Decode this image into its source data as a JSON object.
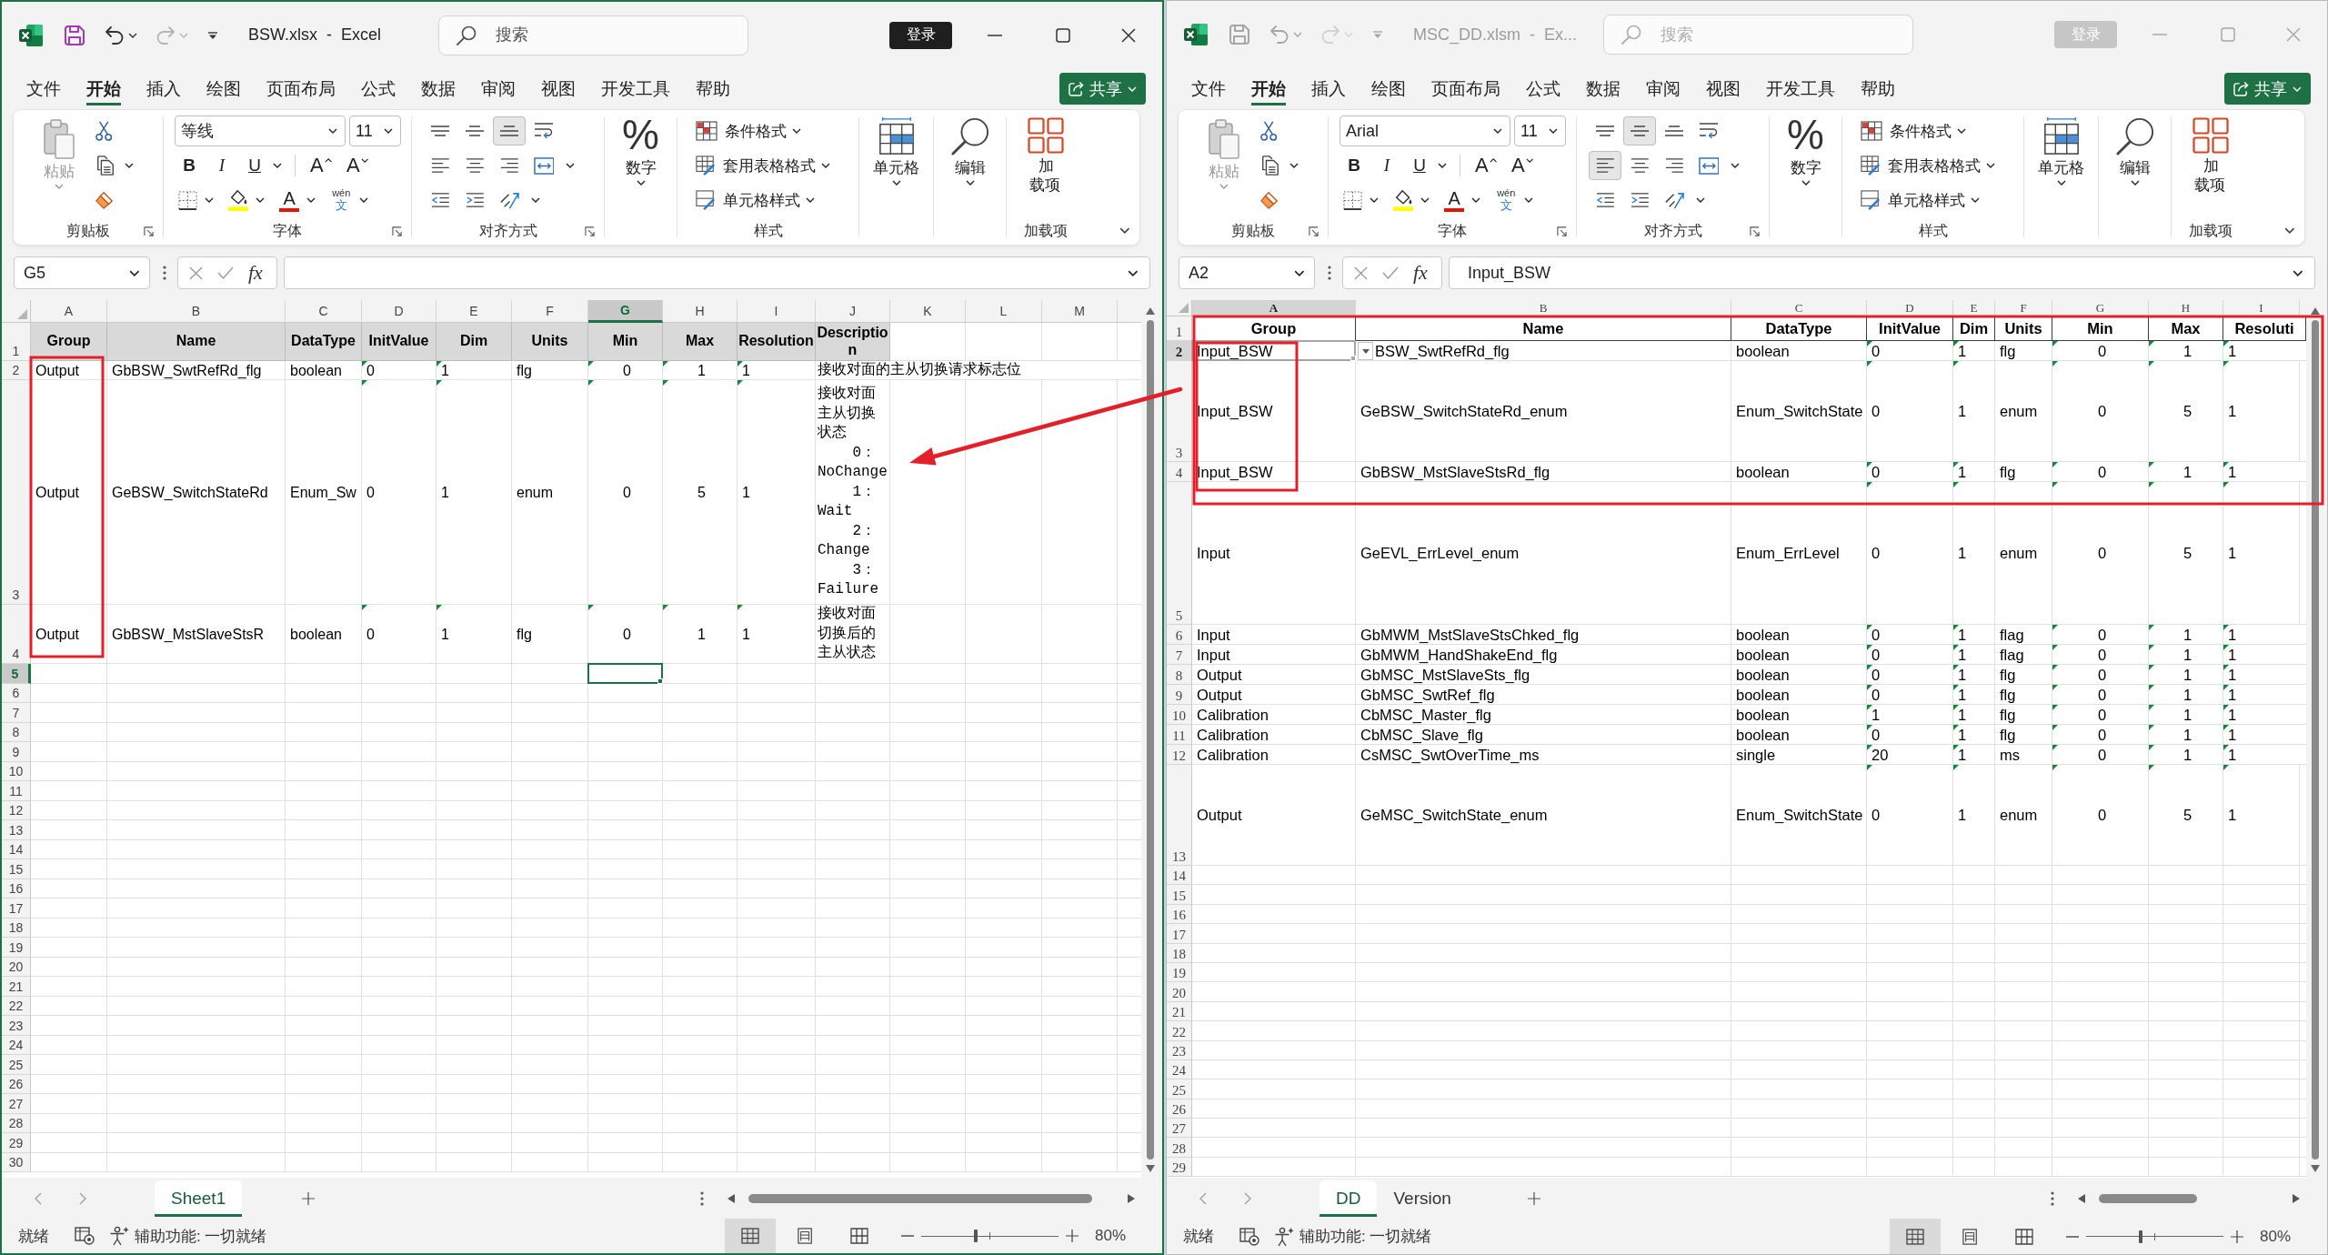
{
  "windows": [
    {
      "active": true,
      "title": "BSW.xlsx  -  Excel",
      "quick_access": [
        {
          "kind": "save",
          "disabled": false
        },
        {
          "kind": "undo",
          "disabled": false
        },
        {
          "kind": "redo",
          "disabled": true
        }
      ],
      "search": {
        "placeholder": "搜索"
      },
      "sign_in": "登录",
      "menu_tabs": [
        {
          "label": "文件",
          "selected": false
        },
        {
          "label": "开始",
          "selected": true
        },
        {
          "label": "插入",
          "selected": false
        },
        {
          "label": "绘图",
          "selected": false
        },
        {
          "label": "页面布局",
          "selected": false
        },
        {
          "label": "公式",
          "selected": false
        },
        {
          "label": "数据",
          "selected": false
        },
        {
          "label": "审阅",
          "selected": false
        },
        {
          "label": "视图",
          "selected": false
        },
        {
          "label": "开发工具",
          "selected": false
        },
        {
          "label": "帮助",
          "selected": false
        }
      ],
      "share": "共享",
      "ribbon": {
        "clipboard": {
          "paste": {
            "label": "粘贴",
            "disabled": true
          },
          "label": "剪贴板"
        },
        "font": {
          "name": "等线",
          "size": "11",
          "styles": [
            {
              "kind": "bold",
              "label": "B"
            },
            {
              "kind": "italic",
              "label": "I"
            },
            {
              "kind": "underline",
              "label": "U"
            }
          ],
          "sizers": [
            {
              "kind": "grow",
              "label": "A"
            },
            {
              "kind": "shrink",
              "label": "A"
            }
          ],
          "font_color": "A",
          "phonetic": {
            "pinyin": "wén",
            "character": "文"
          },
          "label": "字体"
        },
        "alignment": {
          "buttons": [
            {
              "kind": "top",
              "selected": false
            },
            {
              "kind": "middle",
              "selected": false
            },
            {
              "kind": "bottom",
              "selected": true
            },
            {
              "kind": "wrap",
              "selected": false
            },
            {
              "kind": "left",
              "selected": false
            },
            {
              "kind": "center",
              "selected": false
            },
            {
              "kind": "right",
              "selected": false
            },
            {
              "kind": "merge",
              "selected": false
            },
            {
              "kind": "outdent",
              "selected": false
            },
            {
              "kind": "indent",
              "selected": false
            },
            {
              "kind": "orientation",
              "selected": false
            }
          ],
          "label": "对齐方式"
        },
        "number": {
          "symbol": "%",
          "label": "数字"
        },
        "styles": {
          "items": [
            "条件格式",
            "套用表格格式",
            "单元格样式"
          ],
          "label": "样式"
        },
        "cells": {
          "label": "单元格"
        },
        "editing": {
          "label": "编辑"
        },
        "add_ins": {
          "button": "加载项",
          "label": "加载项"
        }
      },
      "name_box": "G5",
      "function_label": "fx",
      "sheet": {
        "columns": [
          {
            "label": "A",
            "selected": false
          },
          {
            "label": "B",
            "selected": false
          },
          {
            "label": "C",
            "selected": false
          },
          {
            "label": "D",
            "selected": false
          },
          {
            "label": "E",
            "selected": false
          },
          {
            "label": "F",
            "selected": false
          },
          {
            "label": "G",
            "selected": true
          },
          {
            "label": "H",
            "selected": false
          },
          {
            "label": "I",
            "selected": false
          },
          {
            "label": "J",
            "selected": false
          },
          {
            "label": "K",
            "selected": false
          },
          {
            "label": "L",
            "selected": false
          },
          {
            "label": "M",
            "selected": false
          }
        ],
        "rows": [
          {
            "number": "1",
            "selected": false,
            "cells": [
              {
                "text": "Group",
                "flagged": false
              },
              {
                "text": "Name",
                "flagged": false
              },
              {
                "text": "DataType",
                "flagged": false
              },
              {
                "text": "InitValue",
                "flagged": false
              },
              {
                "text": "Dim",
                "flagged": false
              },
              {
                "text": "Units",
                "flagged": false
              },
              {
                "text": "Min",
                "flagged": false
              },
              {
                "text": "Max",
                "flagged": false
              },
              {
                "text": "Resolution",
                "flagged": false
              },
              {
                "text": "Description",
                "flagged": false
              }
            ]
          },
          {
            "number": "2",
            "selected": false,
            "cells": [
              {
                "text": "Output",
                "flagged": false
              },
              {
                "text": "GbBSW_SwtRefRd_flg",
                "flagged": false
              },
              {
                "text": "boolean",
                "flagged": false
              },
              {
                "text": "0",
                "flagged": true
              },
              {
                "text": "1",
                "flagged": true
              },
              {
                "text": "flg",
                "flagged": false
              },
              {
                "text": "0",
                "flagged": true
              },
              {
                "text": "1",
                "flagged": true
              },
              {
                "text": "1",
                "flagged": true
              },
              {
                "text": "接收对面的主从切换请求标志位",
                "flagged": false
              }
            ]
          },
          {
            "number": "3",
            "selected": false,
            "cells": [
              {
                "text": "Output",
                "flagged": false
              },
              {
                "text": "GeBSW_SwitchStateRd",
                "flagged": false
              },
              {
                "text": "Enum_Sw",
                "flagged": false
              },
              {
                "text": "0",
                "flagged": true
              },
              {
                "text": "1",
                "flagged": true
              },
              {
                "text": "enum",
                "flagged": false
              },
              {
                "text": "0",
                "flagged": true
              },
              {
                "text": "5",
                "flagged": true
              },
              {
                "text": "1",
                "flagged": true
              },
              {
                "text": "接收对面主从切换状态\n    0：NoChange\n    1：Wait\n    2：Change\n    3：Failure",
                "flagged": false
              }
            ]
          },
          {
            "number": "4",
            "selected": false,
            "cells": [
              {
                "text": "Output",
                "flagged": false
              },
              {
                "text": "GbBSW_MstSlaveStsR",
                "flagged": false
              },
              {
                "text": "boolean",
                "flagged": false
              },
              {
                "text": "0",
                "flagged": true
              },
              {
                "text": "1",
                "flagged": true
              },
              {
                "text": "flg",
                "flagged": false
              },
              {
                "text": "0",
                "flagged": true
              },
              {
                "text": "1",
                "flagged": true
              },
              {
                "text": "1",
                "flagged": true
              },
              {
                "text": "接收对面切换后的主从状态",
                "flagged": false
              }
            ]
          },
          {
            "number": "5",
            "selected": true
          },
          {
            "number": "6",
            "selected": false
          },
          {
            "number": "7",
            "selected": false
          },
          {
            "number": "8",
            "selected": false
          },
          {
            "number": "9",
            "selected": false
          },
          {
            "number": "10",
            "selected": false
          },
          {
            "number": "11",
            "selected": false
          },
          {
            "number": "12",
            "selected": false
          },
          {
            "number": "13",
            "selected": false
          },
          {
            "number": "14",
            "selected": false
          },
          {
            "number": "15",
            "selected": false
          },
          {
            "number": "16",
            "selected": false
          },
          {
            "number": "17",
            "selected": false
          },
          {
            "number": "18",
            "selected": false
          },
          {
            "number": "19",
            "selected": false
          },
          {
            "number": "20",
            "selected": false
          },
          {
            "number": "21",
            "selected": false
          },
          {
            "number": "22",
            "selected": false
          },
          {
            "number": "23",
            "selected": false
          },
          {
            "number": "24",
            "selected": false
          },
          {
            "number": "25",
            "selected": false
          },
          {
            "number": "26",
            "selected": false
          },
          {
            "number": "27",
            "selected": false
          },
          {
            "number": "28",
            "selected": false
          },
          {
            "number": "29",
            "selected": false
          },
          {
            "number": "30",
            "selected": false
          }
        ]
      },
      "sheet_tabs": [
        {
          "label": "Sheet1",
          "selected": true
        }
      ],
      "status": {
        "ready": "就绪",
        "accessibility": "辅助功能: 一切就绪",
        "views": [
          {
            "kind": "normal",
            "selected": true
          },
          {
            "kind": "page_layout",
            "selected": false
          },
          {
            "kind": "page_break",
            "selected": false
          }
        ],
        "zoom_slider": {
          "level": 0.4
        },
        "zoom": "80%"
      }
    },
    {
      "active": false,
      "title": "MSC_DD.xlsm  -  Ex...",
      "quick_access": [
        {
          "kind": "save",
          "disabled": false
        },
        {
          "kind": "undo",
          "disabled": false
        },
        {
          "kind": "redo",
          "disabled": true
        }
      ],
      "search": {
        "placeholder": "搜索"
      },
      "sign_in": "登录",
      "menu_tabs": [
        {
          "label": "文件",
          "selected": false
        },
        {
          "label": "开始",
          "selected": true
        },
        {
          "label": "插入",
          "selected": false
        },
        {
          "label": "绘图",
          "selected": false
        },
        {
          "label": "页面布局",
          "selected": false
        },
        {
          "label": "公式",
          "selected": false
        },
        {
          "label": "数据",
          "selected": false
        },
        {
          "label": "审阅",
          "selected": false
        },
        {
          "label": "视图",
          "selected": false
        },
        {
          "label": "开发工具",
          "selected": false
        },
        {
          "label": "帮助",
          "selected": false
        }
      ],
      "share": "共享",
      "ribbon": {
        "clipboard": {
          "paste": {
            "label": "粘贴",
            "disabled": true
          },
          "label": "剪贴板"
        },
        "font": {
          "name": "Arial",
          "size": "11",
          "styles": [
            {
              "kind": "bold",
              "label": "B"
            },
            {
              "kind": "italic",
              "label": "I"
            },
            {
              "kind": "underline",
              "label": "U"
            }
          ],
          "sizers": [
            {
              "kind": "grow",
              "label": "A"
            },
            {
              "kind": "shrink",
              "label": "A"
            }
          ],
          "font_color": "A",
          "phonetic": {
            "pinyin": "wén",
            "character": "文"
          },
          "label": "字体"
        },
        "alignment": {
          "buttons": [
            {
              "kind": "top",
              "selected": false
            },
            {
              "kind": "middle",
              "selected": true
            },
            {
              "kind": "bottom",
              "selected": false
            },
            {
              "kind": "wrap",
              "selected": false
            },
            {
              "kind": "left",
              "selected": true
            },
            {
              "kind": "center",
              "selected": false
            },
            {
              "kind": "right",
              "selected": false
            },
            {
              "kind": "merge",
              "selected": false
            },
            {
              "kind": "outdent",
              "selected": false
            },
            {
              "kind": "indent",
              "selected": false
            },
            {
              "kind": "orientation",
              "selected": false
            }
          ],
          "label": "对齐方式"
        },
        "number": {
          "symbol": "%",
          "label": "数字"
        },
        "styles": {
          "items": [
            "条件格式",
            "套用表格格式",
            "单元格样式"
          ],
          "label": "样式"
        },
        "cells": {
          "label": "单元格"
        },
        "editing": {
          "label": "编辑"
        },
        "add_ins": {
          "button": "加载项",
          "label": "加载项"
        }
      },
      "name_box": "A2",
      "function_label": "fx",
      "formula": "Input_BSW",
      "sheet": {
        "columns": [
          {
            "label": "A",
            "selected": true
          },
          {
            "label": "B",
            "selected": false
          },
          {
            "label": "C",
            "selected": false
          },
          {
            "label": "D",
            "selected": false
          },
          {
            "label": "E",
            "selected": false
          },
          {
            "label": "F",
            "selected": false
          },
          {
            "label": "G",
            "selected": false
          },
          {
            "label": "H",
            "selected": false
          },
          {
            "label": "I",
            "selected": false
          }
        ],
        "selection_dropdown": true,
        "rows": [
          {
            "number": "1",
            "selected": false,
            "cells": [
              {
                "text": "Group",
                "flagged": false
              },
              {
                "text": "Name",
                "flagged": false
              },
              {
                "text": "DataType",
                "flagged": false
              },
              {
                "text": "InitValue",
                "flagged": false
              },
              {
                "text": "Dim",
                "flagged": false
              },
              {
                "text": "Units",
                "flagged": false
              },
              {
                "text": "Min",
                "flagged": false
              },
              {
                "text": "Max",
                "flagged": false
              },
              {
                "text": "Resoluti",
                "flagged": false
              }
            ]
          },
          {
            "number": "2",
            "selected": true,
            "cells": [
              {
                "text": "Input_BSW",
                "flagged": false
              },
              {
                "text": "BSW_SwtRefRd_flg",
                "flagged": false
              },
              {
                "text": "boolean",
                "flagged": false
              },
              {
                "text": "0",
                "flagged": true
              },
              {
                "text": "1",
                "flagged": true
              },
              {
                "text": "flg",
                "flagged": false
              },
              {
                "text": "0",
                "flagged": true
              },
              {
                "text": "1",
                "flagged": true
              },
              {
                "text": "1",
                "flagged": true
              }
            ]
          },
          {
            "number": "3",
            "selected": false,
            "cells": [
              {
                "text": "Input_BSW",
                "flagged": false
              },
              {
                "text": "GeBSW_SwitchStateRd_enum",
                "flagged": false
              },
              {
                "text": "Enum_SwitchState",
                "flagged": false
              },
              {
                "text": "0",
                "flagged": true
              },
              {
                "text": "1",
                "flagged": true
              },
              {
                "text": "enum",
                "flagged": false
              },
              {
                "text": "0",
                "flagged": true
              },
              {
                "text": "5",
                "flagged": true
              },
              {
                "text": "1",
                "flagged": true
              }
            ]
          },
          {
            "number": "4",
            "selected": false,
            "cells": [
              {
                "text": "Input_BSW",
                "flagged": false
              },
              {
                "text": "GbBSW_MstSlaveStsRd_flg",
                "flagged": false
              },
              {
                "text": "boolean",
                "flagged": false
              },
              {
                "text": "0",
                "flagged": true
              },
              {
                "text": "1",
                "flagged": true
              },
              {
                "text": "flg",
                "flagged": false
              },
              {
                "text": "0",
                "flagged": true
              },
              {
                "text": "1",
                "flagged": true
              },
              {
                "text": "1",
                "flagged": true
              }
            ]
          },
          {
            "number": "5",
            "selected": false,
            "cells": [
              {
                "text": "Input",
                "flagged": false
              },
              {
                "text": "GeEVL_ErrLevel_enum",
                "flagged": false
              },
              {
                "text": "Enum_ErrLevel",
                "flagged": false
              },
              {
                "text": "0",
                "flagged": true
              },
              {
                "text": "1",
                "flagged": true
              },
              {
                "text": "enum",
                "flagged": false
              },
              {
                "text": "0",
                "flagged": true
              },
              {
                "text": "5",
                "flagged": true
              },
              {
                "text": "1",
                "flagged": true
              }
            ]
          },
          {
            "number": "6",
            "selected": false,
            "cells": [
              {
                "text": "Input",
                "flagged": false
              },
              {
                "text": "GbMWM_MstSlaveStsChked_flg",
                "flagged": false
              },
              {
                "text": "boolean",
                "flagged": false
              },
              {
                "text": "0",
                "flagged": true
              },
              {
                "text": "1",
                "flagged": true
              },
              {
                "text": "flag",
                "flagged": false
              },
              {
                "text": "0",
                "flagged": true
              },
              {
                "text": "1",
                "flagged": true
              },
              {
                "text": "1",
                "flagged": true
              }
            ]
          },
          {
            "number": "7",
            "selected": false,
            "cells": [
              {
                "text": "Input",
                "flagged": false
              },
              {
                "text": "GbMWM_HandShakeEnd_flg",
                "flagged": false
              },
              {
                "text": "boolean",
                "flagged": false
              },
              {
                "text": "0",
                "flagged": true
              },
              {
                "text": "1",
                "flagged": true
              },
              {
                "text": "flag",
                "flagged": false
              },
              {
                "text": "0",
                "flagged": true
              },
              {
                "text": "1",
                "flagged": true
              },
              {
                "text": "1",
                "flagged": true
              }
            ]
          },
          {
            "number": "8",
            "selected": false,
            "cells": [
              {
                "text": "Output",
                "flagged": false
              },
              {
                "text": "GbMSC_MstSlaveSts_flg",
                "flagged": false
              },
              {
                "text": "boolean",
                "flagged": false
              },
              {
                "text": "0",
                "flagged": true
              },
              {
                "text": "1",
                "flagged": true
              },
              {
                "text": "flg",
                "flagged": false
              },
              {
                "text": "0",
                "flagged": true
              },
              {
                "text": "1",
                "flagged": true
              },
              {
                "text": "1",
                "flagged": true
              }
            ]
          },
          {
            "number": "9",
            "selected": false,
            "cells": [
              {
                "text": "Output",
                "flagged": false
              },
              {
                "text": "GbMSC_SwtRef_flg",
                "flagged": false
              },
              {
                "text": "boolean",
                "flagged": false
              },
              {
                "text": "0",
                "flagged": true
              },
              {
                "text": "1",
                "flagged": true
              },
              {
                "text": "flg",
                "flagged": false
              },
              {
                "text": "0",
                "flagged": true
              },
              {
                "text": "1",
                "flagged": true
              },
              {
                "text": "1",
                "flagged": true
              }
            ]
          },
          {
            "number": "10",
            "selected": false,
            "cells": [
              {
                "text": "Calibration",
                "flagged": false
              },
              {
                "text": "CbMSC_Master_flg",
                "flagged": false
              },
              {
                "text": "boolean",
                "flagged": false
              },
              {
                "text": "1",
                "flagged": true
              },
              {
                "text": "1",
                "flagged": true
              },
              {
                "text": "flg",
                "flagged": false
              },
              {
                "text": "0",
                "flagged": true
              },
              {
                "text": "1",
                "flagged": true
              },
              {
                "text": "1",
                "flagged": true
              }
            ]
          },
          {
            "number": "11",
            "selected": false,
            "cells": [
              {
                "text": "Calibration",
                "flagged": false
              },
              {
                "text": "CbMSC_Slave_flg",
                "flagged": false
              },
              {
                "text": "boolean",
                "flagged": false
              },
              {
                "text": "0",
                "flagged": true
              },
              {
                "text": "1",
                "flagged": true
              },
              {
                "text": "flg",
                "flagged": false
              },
              {
                "text": "0",
                "flagged": true
              },
              {
                "text": "1",
                "flagged": true
              },
              {
                "text": "1",
                "flagged": true
              }
            ]
          },
          {
            "number": "12",
            "selected": false,
            "cells": [
              {
                "text": "Calibration",
                "flagged": false
              },
              {
                "text": "CsMSC_SwtOverTime_ms",
                "flagged": false
              },
              {
                "text": "single",
                "flagged": false
              },
              {
                "text": "20",
                "flagged": true
              },
              {
                "text": "1",
                "flagged": true
              },
              {
                "text": "ms",
                "flagged": false
              },
              {
                "text": "0",
                "flagged": true
              },
              {
                "text": "1",
                "flagged": true
              },
              {
                "text": "1",
                "flagged": true
              }
            ]
          },
          {
            "number": "13",
            "selected": false,
            "cells": [
              {
                "text": "Output",
                "flagged": false
              },
              {
                "text": "GeMSC_SwitchState_enum",
                "flagged": false
              },
              {
                "text": "Enum_SwitchState",
                "flagged": false
              },
              {
                "text": "0",
                "flagged": true
              },
              {
                "text": "1",
                "flagged": true
              },
              {
                "text": "enum",
                "flagged": false
              },
              {
                "text": "0",
                "flagged": true
              },
              {
                "text": "5",
                "flagged": true
              },
              {
                "text": "1",
                "flagged": true
              }
            ]
          },
          {
            "number": "14",
            "selected": false
          },
          {
            "number": "15",
            "selected": false
          },
          {
            "number": "16",
            "selected": false
          },
          {
            "number": "17",
            "selected": false
          },
          {
            "number": "18",
            "selected": false
          },
          {
            "number": "19",
            "selected": false
          },
          {
            "number": "20",
            "selected": false
          },
          {
            "number": "21",
            "selected": false
          },
          {
            "number": "22",
            "selected": false
          },
          {
            "number": "23",
            "selected": false
          },
          {
            "number": "24",
            "selected": false
          },
          {
            "number": "25",
            "selected": false
          },
          {
            "number": "26",
            "selected": false
          },
          {
            "number": "27",
            "selected": false
          },
          {
            "number": "28",
            "selected": false
          },
          {
            "number": "29",
            "selected": false
          }
        ]
      },
      "sheet_tabs": [
        {
          "label": "DD",
          "selected": true
        },
        {
          "label": "Version",
          "selected": false
        }
      ],
      "status": {
        "ready": "就绪",
        "accessibility": "辅助功能: 一切就绪",
        "views": [
          {
            "kind": "normal",
            "selected": true
          },
          {
            "kind": "page_layout",
            "selected": false
          },
          {
            "kind": "page_break",
            "selected": false
          }
        ],
        "zoom_slider": {
          "level": 0.4
        },
        "zoom": "80%"
      }
    }
  ]
}
